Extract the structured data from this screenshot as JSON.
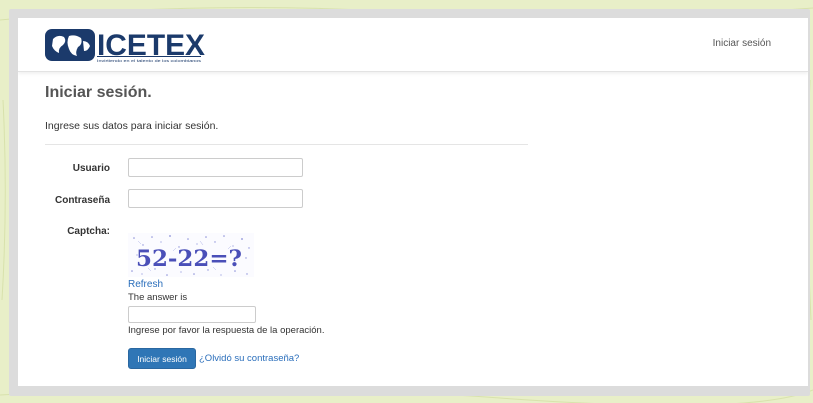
{
  "navbar": {
    "logo_text": "ICETEX",
    "logo_tagline": "Invirtiendo en el talento de los colombianos",
    "login_link": "Iniciar sesión"
  },
  "main": {
    "title": "Iniciar sesión.",
    "subtitle": "Ingrese sus datos para iniciar sesión."
  },
  "form": {
    "username_label": "Usuario",
    "username_value": "",
    "password_label": "Contraseña",
    "password_value": "",
    "captcha_label": "Captcha:",
    "captcha_image_text": "52-22=?",
    "refresh_link": "Refresh",
    "answer_label": "The answer is",
    "answer_value": "",
    "answer_hint": "Ingrese por favor la respuesta de la operación.",
    "submit_label": "Iniciar sesión",
    "forgot_link": "¿Olvidó su contraseña?"
  },
  "colors": {
    "page_background": "#e8efc8",
    "button_blue": "#2f76b6",
    "link_blue": "#2a6ebb",
    "logo_navy": "#1b3a6b"
  }
}
